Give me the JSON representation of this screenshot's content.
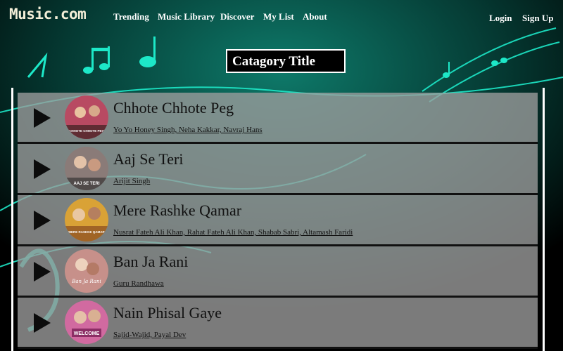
{
  "header": {
    "logo": "Music.com",
    "nav": [
      "Trending",
      "Music Library",
      "Discover",
      "My List",
      "About"
    ],
    "login": "Login",
    "signup": "Sign Up"
  },
  "category": {
    "title": "Catagory Title"
  },
  "songs": [
    {
      "title": "Chhote Chhote Peg",
      "artists": "Yo Yo Honey Singh, Neha Kakkar, Navraj Hans",
      "cover_text": "CHHOTE CHHOTE PEG",
      "cover_color": "#b84a62"
    },
    {
      "title": "Aaj Se Teri",
      "artists": "Arijit Singh",
      "cover_text": "AAJ SE TERI",
      "cover_color": "#8a7b78"
    },
    {
      "title": "Mere Rashke Qamar",
      "artists": "Nusrat Fateh Ali Khan, Rahat Fateh Ali Khan, Shabab Sabri, Altamash Faridi",
      "cover_text": "MERE RASHKE QAMAR",
      "cover_color": "#d9a236"
    },
    {
      "title": "Ban Ja Rani",
      "artists": "Guru Randhawa",
      "cover_text": "Ban Ja Rani",
      "cover_color": "#c7908a"
    },
    {
      "title": "Nain Phisal Gaye",
      "artists": "Sajid-Wajid, Payal Dev",
      "cover_text": "WELCOME",
      "cover_color": "#d16aa0"
    }
  ],
  "colors": {
    "accent": "#1de8c8",
    "row_bg": "#9e9e9e",
    "topbar": "#000000"
  }
}
